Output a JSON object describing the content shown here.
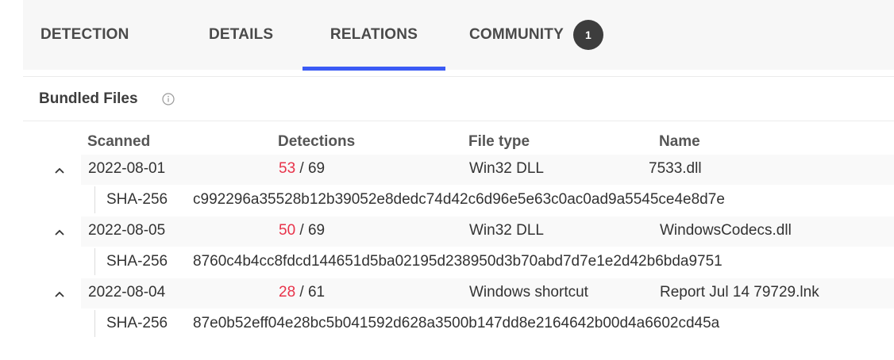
{
  "tabs": {
    "detection": "DETECTION",
    "details": "DETAILS",
    "relations": "RELATIONS",
    "community": "COMMUNITY",
    "community_count": "1",
    "active": "RELATIONS",
    "active_color": "#3b5bf5"
  },
  "section": {
    "title": "Bundled Files",
    "info_icon": "info-icon"
  },
  "table": {
    "columns": [
      "Scanned",
      "Detections",
      "File type",
      "Name"
    ],
    "rows": [
      {
        "scanned": "2022-08-01",
        "detected": "53",
        "total": "/ 69",
        "file_type": "Win32 DLL",
        "name": "7533.dll",
        "hash_label": "SHA-256",
        "hash": "c992296a35528b12b39052e8dedc74d42c6d96e5e63c0ac0ad9a5545ce4e8d7e"
      },
      {
        "scanned": "2022-08-05",
        "detected": "50",
        "total": "/ 69",
        "file_type": "Win32 DLL",
        "name": "WindowsCodecs.dll",
        "hash_label": "SHA-256",
        "hash": "8760c4b4cc8fdcd144651d5ba02195d238950d3b70abd7d7e1e2d42b6bda9751"
      },
      {
        "scanned": "2022-08-04",
        "detected": "28",
        "total": "/ 61",
        "file_type": "Windows shortcut",
        "name": "Report Jul 14 79729.lnk",
        "hash_label": "SHA-256",
        "hash": "87e0b52eff04e28bc5b041592d628a3500b147dd8e2164642b00d4a6602cd45a"
      }
    ],
    "detection_color": "#e8334a",
    "expand_icon": "chevron-up-icon"
  }
}
